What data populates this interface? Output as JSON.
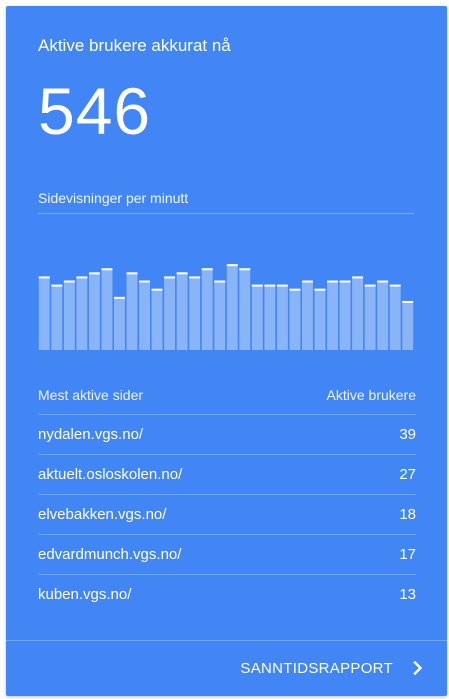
{
  "card": {
    "title": "Aktive brukere akkurat nå",
    "active_users": "546"
  },
  "chart": {
    "label": "Sidevisninger per minutt",
    "bar_color": "#8ab4f8",
    "cap_color": "#ffffff"
  },
  "chart_data": {
    "type": "bar",
    "title": "Sidevisninger per minutt",
    "values": [
      18,
      16,
      17,
      18,
      19,
      20,
      13,
      19,
      17,
      15,
      18,
      19,
      18,
      20,
      17,
      21,
      20,
      16,
      16,
      16,
      15,
      17,
      15,
      17,
      17,
      18,
      16,
      17,
      16,
      12
    ],
    "ylim": [
      0,
      23
    ],
    "grid": false
  },
  "table": {
    "col_page": "Mest aktive sider",
    "col_users": "Aktive brukere",
    "rows": [
      {
        "page": "nydalen.vgs.no/",
        "users": "39"
      },
      {
        "page": "aktuelt.osloskolen.no/",
        "users": "27"
      },
      {
        "page": "elvebakken.vgs.no/",
        "users": "18"
      },
      {
        "page": "edvardmunch.vgs.no/",
        "users": "17"
      },
      {
        "page": "kuben.vgs.no/",
        "users": "13"
      }
    ]
  },
  "footer": {
    "link_label": "SANNTIDSRAPPORT",
    "icon": "chevron-right-icon"
  },
  "colors": {
    "card_bg": "#4285f4",
    "text": "#ffffff"
  }
}
